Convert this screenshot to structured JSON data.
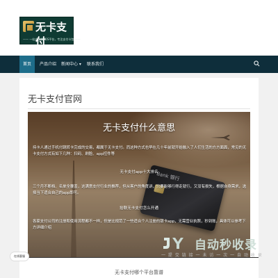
{
  "site": {
    "logo_text": "无卡支付",
    "logo_tagline": "—— 一站式手机POS平台，专注支付卡包 ——"
  },
  "nav": {
    "items": [
      {
        "label": "首页"
      },
      {
        "label": "产品介绍"
      },
      {
        "label": "新闻中心 ▾"
      },
      {
        "label": "联系我们"
      }
    ],
    "active_index": 0
  },
  "page": {
    "title": "无卡支付官网"
  },
  "article": {
    "heading": "无卡支付什么意思",
    "para1": "持卡人通过手机付跳转卡完成的交易，都属于无卡支付。而这种方式也早在几十年前就开始融入了人们生活的方方面面，常见的无卡支付方式有如下几种：扫码、刷脸、app控件等",
    "sub1": "无卡支付app十大排名",
    "para2": "三个月不断档、名单全覆盖，这满意支付行业的推荐，但从客户的角度讲，只要能够行得走就行，又没有损失，根据自身需求，选择当下适合自己的app即可。",
    "sub2": "抬联无卡支付怎么开通",
    "para3": "各家支付公司的注册和使用流程都不一样，但是比规范了一些适合个人注册的银卡app，无需营业执照，秒到账，具体可以参考下方详细介绍",
    "card_brand": "Bank 银行"
  },
  "next_article": {
    "title": "无卡支付哪个平台靠谱"
  },
  "watermark": {
    "text": "自动秒收录",
    "sub": "一 提 交 链 接 一 未 访 一 次 一 自 动 收 录"
  },
  "side_badge": {
    "label": "在线客服"
  },
  "colors": {
    "nav_bg": "#0e2e3b",
    "nav_active": "#1e6d8a",
    "logo_bg": "#0f3b33"
  }
}
